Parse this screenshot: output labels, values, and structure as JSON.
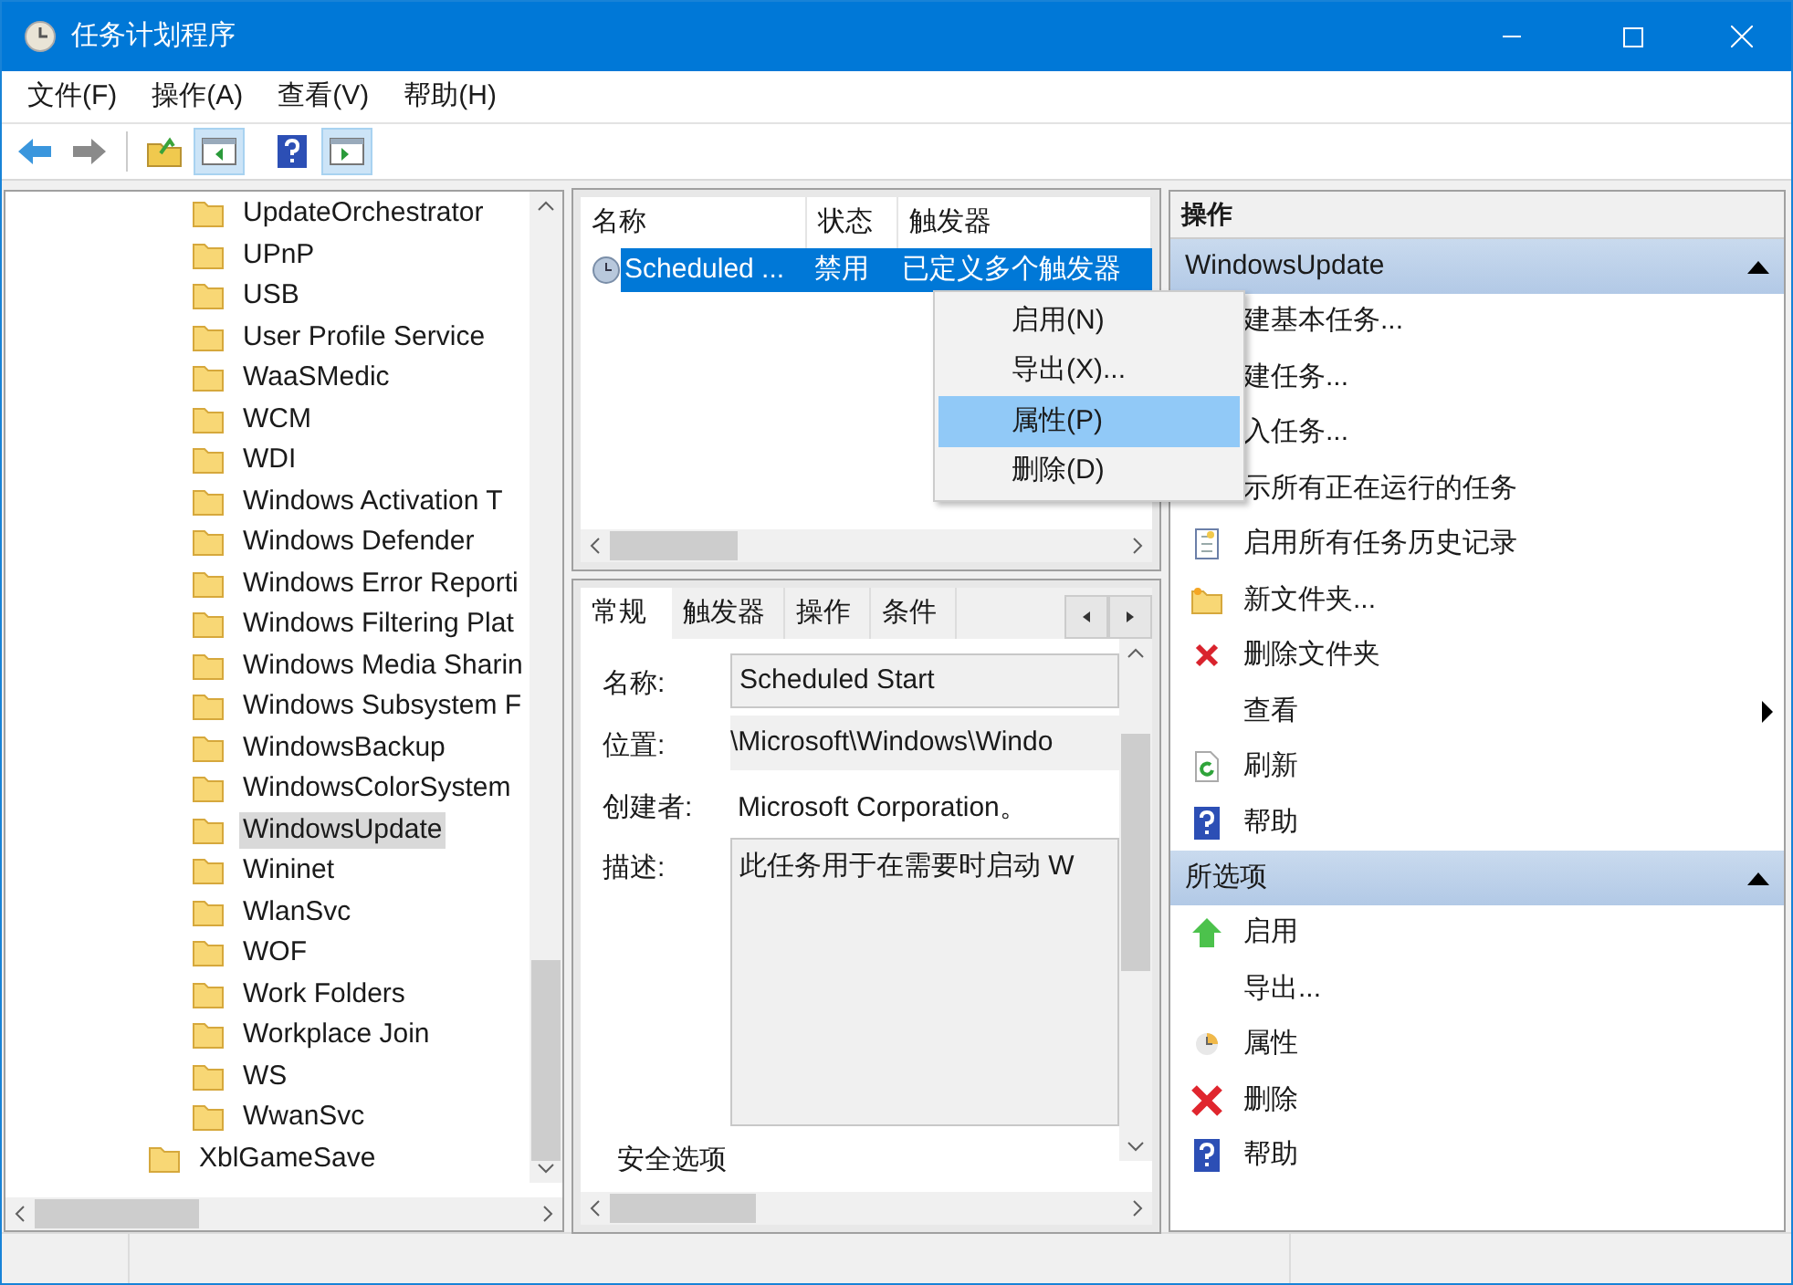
{
  "window": {
    "title": "任务计划程序"
  },
  "menu": [
    "文件(F)",
    "操作(A)",
    "查看(V)",
    "帮助(H)"
  ],
  "toolbar": [
    {
      "kind": "back",
      "pressed": false
    },
    {
      "kind": "forward",
      "pressed": false
    },
    {
      "kind": "up",
      "pressed": false
    },
    {
      "kind": "tree-pane",
      "pressed": true
    },
    {
      "kind": "help",
      "pressed": false
    },
    {
      "kind": "action-pane",
      "pressed": true
    }
  ],
  "tree": [
    {
      "children": [
        {
          "label": "UpdateOrchestrator",
          "selected": false
        },
        {
          "label": "UPnP",
          "selected": false
        },
        {
          "label": "USB",
          "selected": false
        },
        {
          "label": "User Profile Service",
          "selected": false
        },
        {
          "label": "WaaSMedic",
          "selected": false
        },
        {
          "label": "WCM",
          "selected": false
        },
        {
          "label": "WDI",
          "selected": false
        },
        {
          "label": "Windows Activation T",
          "selected": false
        },
        {
          "label": "Windows Defender",
          "selected": false
        },
        {
          "label": "Windows Error Reporti",
          "selected": false
        },
        {
          "label": "Windows Filtering Plat",
          "selected": false
        },
        {
          "label": "Windows Media Sharin",
          "selected": false
        },
        {
          "label": "Windows Subsystem F",
          "selected": false
        },
        {
          "label": "WindowsBackup",
          "selected": false
        },
        {
          "label": "WindowsColorSystem",
          "selected": false
        },
        {
          "label": "WindowsUpdate",
          "selected": true
        },
        {
          "label": "Wininet",
          "selected": false
        },
        {
          "label": "WlanSvc",
          "selected": false
        },
        {
          "label": "WOF",
          "selected": false
        },
        {
          "label": "Work Folders",
          "selected": false
        },
        {
          "label": "Workplace Join",
          "selected": false
        },
        {
          "label": "WS",
          "selected": false
        },
        {
          "label": "WwanSvc",
          "selected": false
        }
      ]
    },
    {
      "label": "XblGameSave",
      "selected": false
    }
  ],
  "task_list": {
    "columns": [
      "名称",
      "状态",
      "触发器"
    ],
    "rows": [
      {
        "name": "Scheduled ...",
        "status": "禁用",
        "trigger": "已定义多个触发器",
        "selected": true
      }
    ]
  },
  "context_menu": [
    {
      "label": "启用(N)",
      "selected": false
    },
    {
      "label": "导出(X)...",
      "selected": false
    },
    {
      "label": "属性(P)",
      "selected": true
    },
    {
      "label": "删除(D)",
      "selected": false
    }
  ],
  "details": {
    "tabs": [
      {
        "label": "常规",
        "selected": true
      },
      {
        "label": "触发器",
        "selected": false
      },
      {
        "label": "操作",
        "selected": false
      },
      {
        "label": "条件",
        "selected": false
      }
    ],
    "fields": [
      {
        "label": "名称:",
        "value": "Scheduled Start",
        "kind": "field"
      },
      {
        "label": "位置:",
        "value": "\\Microsoft\\Windows\\Windo",
        "kind": "readonly"
      },
      {
        "label": "创建者:",
        "value": "Microsoft Corporation。",
        "kind": "text"
      },
      {
        "label": "描述:",
        "value": "此任务用于在需要时启动 W",
        "kind": "area"
      }
    ],
    "section": "安全选项"
  },
  "actions": {
    "title": "操作",
    "sections": [
      {
        "title": "WindowsUpdate",
        "expanded": true,
        "items": [
          {
            "label": "建基本任务...",
            "kind": "hidden"
          },
          {
            "label": "建任务...",
            "kind": "hidden"
          },
          {
            "label": "入任务...",
            "kind": "hidden"
          },
          {
            "label": "示所有正在运行的任务",
            "kind": "hidden"
          },
          {
            "label": "启用所有任务历史记录",
            "kind": "history"
          },
          {
            "label": "新文件夹...",
            "kind": "folder"
          },
          {
            "label": "删除文件夹",
            "kind": "x"
          },
          {
            "label": "查看",
            "kind": "none",
            "submenu": true
          },
          {
            "label": "刷新",
            "kind": "refresh"
          },
          {
            "label": "帮助",
            "kind": "help"
          }
        ]
      },
      {
        "title": "所选项",
        "expanded": true,
        "items": [
          {
            "label": "启用",
            "kind": "up-arrow"
          },
          {
            "label": "导出...",
            "kind": "none"
          },
          {
            "label": "属性",
            "kind": "clock"
          },
          {
            "label": "删除",
            "kind": "big-x"
          },
          {
            "label": "帮助",
            "kind": "help"
          }
        ]
      }
    ]
  }
}
